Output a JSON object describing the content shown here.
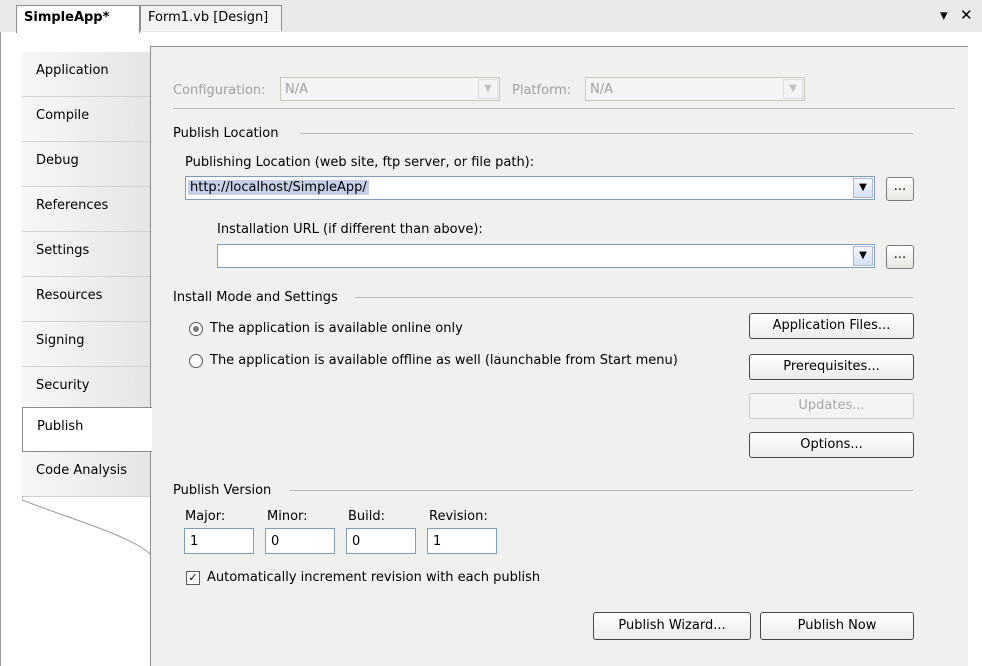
{
  "doc_tabs": {
    "active": "SimpleApp*",
    "inactive": "Form1.vb [Design]",
    "dropdown_glyph": "▾",
    "close_glyph": "✕"
  },
  "sidebar": {
    "items": [
      {
        "label": "Application"
      },
      {
        "label": "Compile"
      },
      {
        "label": "Debug"
      },
      {
        "label": "References"
      },
      {
        "label": "Settings"
      },
      {
        "label": "Resources"
      },
      {
        "label": "Signing"
      },
      {
        "label": "Security"
      },
      {
        "label": "Publish",
        "selected": true
      },
      {
        "label": "Code Analysis"
      }
    ]
  },
  "config": {
    "configuration_label": "Configuration:",
    "configuration_value": "N/A",
    "platform_label": "Platform:",
    "platform_value": "N/A"
  },
  "publish_location": {
    "group_title": "Publish Location",
    "location_label": "Publishing Location (web site, ftp server, or file path):",
    "location_value": "http://localhost/SimpleApp/",
    "install_url_label": "Installation URL (if different than above):",
    "install_url_value": "",
    "browse_label": "..."
  },
  "install_mode": {
    "group_title": "Install Mode and Settings",
    "online_label": "The application is available online only",
    "offline_label": "The application is available offline as well (launchable from Start menu)",
    "selected": "online",
    "buttons": {
      "application_files": "Application Files...",
      "prerequisites": "Prerequisites...",
      "updates": "Updates...",
      "options": "Options..."
    }
  },
  "publish_version": {
    "group_title": "Publish Version",
    "major_label": "Major:",
    "minor_label": "Minor:",
    "build_label": "Build:",
    "revision_label": "Revision:",
    "major": "1",
    "minor": "0",
    "build": "0",
    "revision": "1",
    "auto_increment_label": "Automatically increment revision with each publish",
    "auto_increment_checked": true
  },
  "actions": {
    "wizard": "Publish Wizard...",
    "publish_now": "Publish Now"
  },
  "colors": {
    "selection_highlight": "#c5d0e6",
    "panel_background": "#f0f0ef"
  }
}
